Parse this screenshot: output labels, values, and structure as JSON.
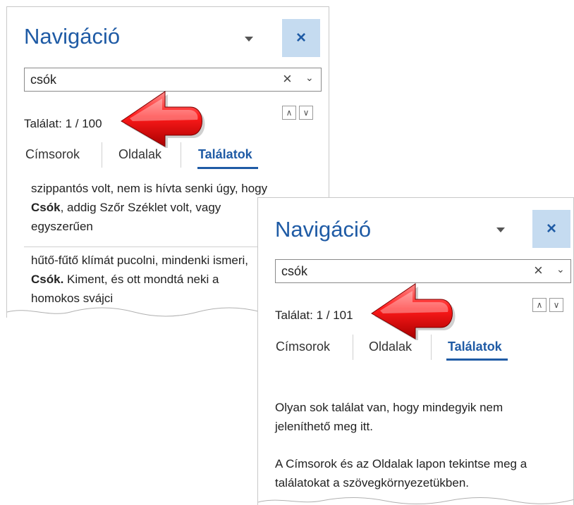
{
  "panel1": {
    "title": "Navigáció",
    "close_label": "×",
    "search_value": "csók",
    "clear_label": "×",
    "dropdown_label": "⌄",
    "up_label": "∧",
    "down_label": "∨",
    "result_count": "Találat: 1 / 100",
    "tabs": [
      "Címsorok",
      "Oldalak",
      "Találatok"
    ],
    "results": [
      {
        "before": "szippantós volt, nem is hívta senki úgy, hogy ",
        "match": "Csók",
        "after": ", addig Szőr Széklet volt, vagy egyszerűen"
      },
      {
        "before": "hűtő-fűtő klímát pucolni, mindenki ismeri, ",
        "match": "Csók.",
        "after": " Kiment, és ott mondtá neki a homokos svájci"
      }
    ]
  },
  "panel2": {
    "title": "Navigáció",
    "close_label": "×",
    "search_value": "csók",
    "clear_label": "×",
    "dropdown_label": "⌄",
    "up_label": "∧",
    "down_label": "∨",
    "result_count": "Találat: 1 / 101",
    "tabs": [
      "Címsorok",
      "Oldalak",
      "Találatok"
    ],
    "message1": "Olyan sok találat van, hogy mindegyik nem jeleníthető meg itt.",
    "message2": "A Címsorok és az Oldalak lapon tekintse meg a találatokat a szövegkörnyezetükben."
  },
  "colors": {
    "accent": "#1f5ba5",
    "close_bg": "#c5dbf0",
    "arrow": "#e8141b"
  },
  "icons": [
    "dropdown-icon",
    "close-icon",
    "clear-icon",
    "chevron-down-icon",
    "arrow-up-icon",
    "arrow-down-icon",
    "red-pointer-arrow"
  ]
}
